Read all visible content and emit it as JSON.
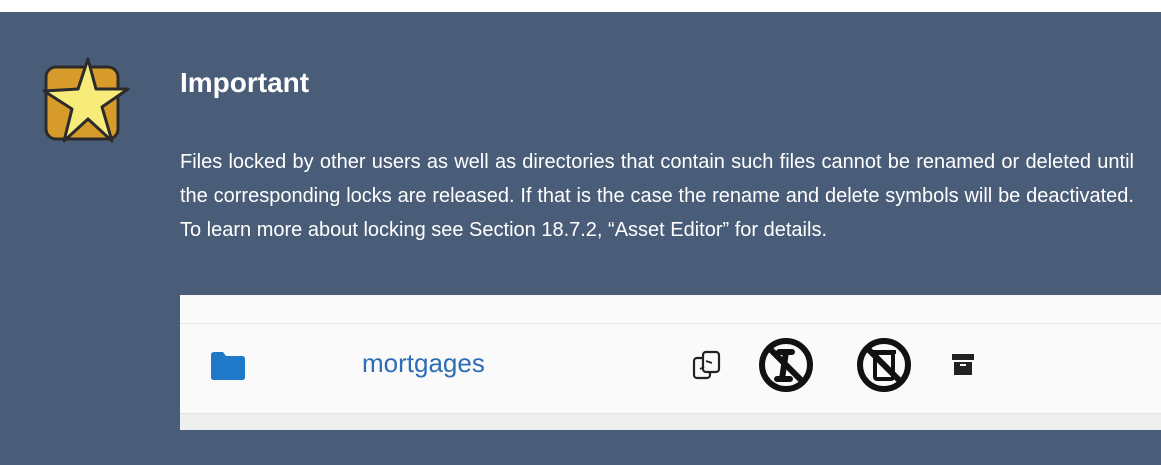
{
  "admonition": {
    "title": "Important",
    "body": "Files locked by other users as well as directories that contain such files cannot be renamed or deleted until the corresponding locks are released. If that is the case the rename and delete symbols will be deactivated. To learn more about locking see Section 18.7.2, “Asset Editor” for details.",
    "icon": "star-icon"
  },
  "screenshot": {
    "row": {
      "icon": "folder-icon",
      "name": "mortgages",
      "actions": [
        {
          "icon": "copy-icon"
        },
        {
          "icon": "rename-disabled-icon"
        },
        {
          "icon": "delete-disabled-icon"
        },
        {
          "icon": "archive-icon"
        }
      ]
    }
  },
  "colors": {
    "background": "#4a5d78",
    "link": "#2d6db5",
    "star": "#f5e26b"
  }
}
